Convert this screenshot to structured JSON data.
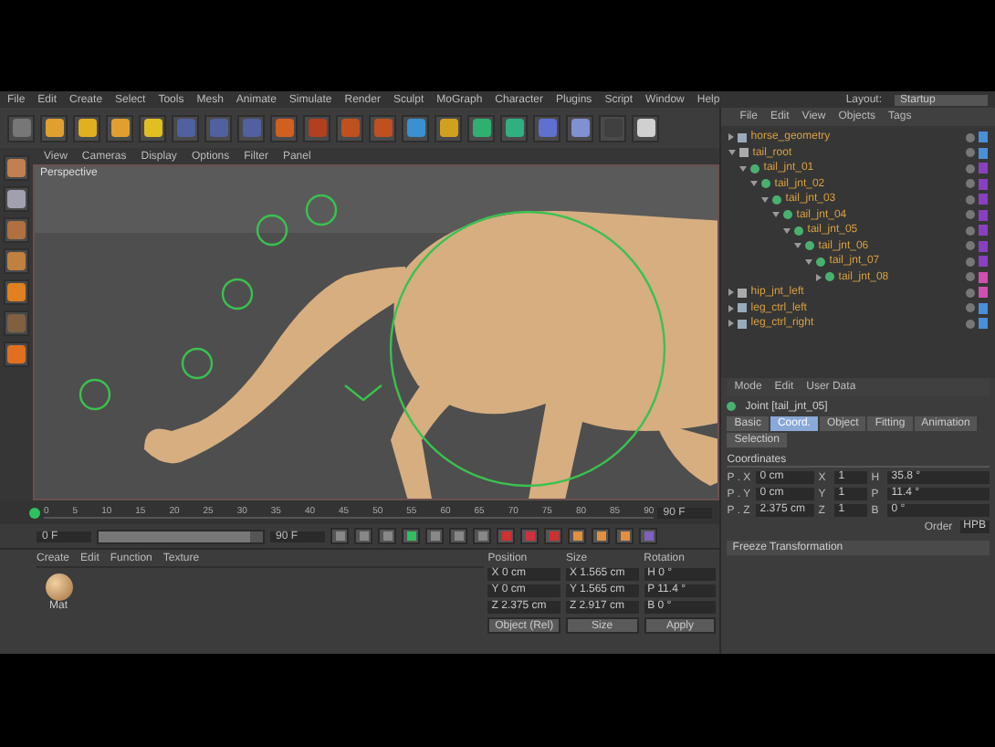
{
  "menu": [
    "File",
    "Edit",
    "Create",
    "Select",
    "Tools",
    "Mesh",
    "Animate",
    "Simulate",
    "Render",
    "Sculpt",
    "MoGraph",
    "Character",
    "Plugins",
    "Script",
    "Window",
    "Help"
  ],
  "layout": {
    "label": "Layout:",
    "value": "Startup"
  },
  "viewport": {
    "menu": [
      "View",
      "Cameras",
      "Display",
      "Options",
      "Filter",
      "Panel"
    ],
    "camera": "Perspective"
  },
  "timeline": {
    "ticks": [
      "0",
      "5",
      "10",
      "15",
      "20",
      "25",
      "30",
      "35",
      "40",
      "45",
      "50",
      "55",
      "60",
      "65",
      "70",
      "75",
      "80",
      "85",
      "90"
    ],
    "end_frame": "90 F"
  },
  "transport": {
    "start_field": "0 F",
    "end_field": "90 F",
    "range": {
      "level": 0.92
    }
  },
  "materials": {
    "menu": [
      "Create",
      "Edit",
      "Function",
      "Texture"
    ],
    "items": [
      {
        "name": "Mat"
      }
    ]
  },
  "coordinates": {
    "headers": [
      "Position",
      "Size",
      "Rotation"
    ],
    "rows": [
      {
        "position": "X 0 cm",
        "size": "X 1.565 cm",
        "rotation": "H 0 °"
      },
      {
        "position": "Y 0 cm",
        "size": "Y 1.565 cm",
        "rotation": "P 11.4 °"
      },
      {
        "position": "Z 2.375 cm",
        "size": "Z 2.917 cm",
        "rotation": "B 0 °"
      }
    ],
    "mode": "Object (Rel)",
    "size_mode": "Size",
    "apply": "Apply"
  },
  "objects": {
    "menu": [
      "File",
      "Edit",
      "View",
      "Objects",
      "Tags"
    ],
    "tree": [
      {
        "name": "horse_geometry",
        "kind": "mesh",
        "expanded": false,
        "color": "#4a8fd8"
      },
      {
        "name": "tail_root",
        "kind": "null",
        "expanded": true,
        "color": "#4a8fd8",
        "children": [
          {
            "name": "tail_jnt_01",
            "kind": "joint",
            "expanded": true,
            "color": "#8a3fc0",
            "children": [
              {
                "name": "tail_jnt_02",
                "kind": "joint",
                "expanded": true,
                "color": "#8a3fc0",
                "children": [
                  {
                    "name": "tail_jnt_03",
                    "kind": "joint",
                    "expanded": true,
                    "color": "#8a3fc0",
                    "children": [
                      {
                        "name": "tail_jnt_04",
                        "kind": "joint",
                        "expanded": true,
                        "color": "#8a3fc0",
                        "children": [
                          {
                            "name": "tail_jnt_05",
                            "kind": "joint",
                            "expanded": true,
                            "color": "#8a3fc0",
                            "children": [
                              {
                                "name": "tail_jnt_06",
                                "kind": "joint",
                                "expanded": true,
                                "color": "#8a3fc0",
                                "children": [
                                  {
                                    "name": "tail_jnt_07",
                                    "kind": "joint",
                                    "expanded": true,
                                    "color": "#8a3fc0",
                                    "children": [
                                      {
                                        "name": "tail_jnt_08",
                                        "kind": "joint",
                                        "expanded": false,
                                        "color": "#d050b0"
                                      }
                                    ]
                                  }
                                ]
                              }
                            ]
                          }
                        ]
                      }
                    ]
                  }
                ]
              }
            ]
          }
        ]
      },
      {
        "name": "hip_jnt_left",
        "kind": "null",
        "expanded": false,
        "color": "#d050b0"
      },
      {
        "name": "leg_ctrl_left",
        "kind": "mesh",
        "expanded": false,
        "color": "#4a8fd8"
      },
      {
        "name": "leg_ctrl_right",
        "kind": "mesh",
        "expanded": false,
        "color": "#4a8fd8"
      }
    ]
  },
  "attributes": {
    "menu": [
      "Mode",
      "Edit",
      "User Data"
    ],
    "object": "Joint [tail_jnt_05]",
    "tabs": [
      {
        "label": "Basic",
        "selected": false
      },
      {
        "label": "Coord.",
        "selected": true
      },
      {
        "label": "Object",
        "selected": false
      },
      {
        "label": "Fitting",
        "selected": false
      },
      {
        "label": "Animation",
        "selected": false
      },
      {
        "label": "Selection",
        "selected": false
      }
    ],
    "section": "Coordinates",
    "rows": [
      {
        "label": "P . X",
        "value": "0 cm",
        "s_axis": "X",
        "s_value": "1",
        "r_axis": "H",
        "rotation": "35.8 °"
      },
      {
        "label": "P . Y",
        "value": "0 cm",
        "s_axis": "Y",
        "s_value": "1",
        "r_axis": "P",
        "rotation": "11.4 °"
      },
      {
        "label": "P . Z",
        "value": "2.375 cm",
        "s_axis": "Z",
        "s_value": "1",
        "r_axis": "B",
        "rotation": "0 °"
      }
    ],
    "order_label": "Order",
    "order_value": "HPB",
    "freeze": "Freeze Transformation"
  }
}
